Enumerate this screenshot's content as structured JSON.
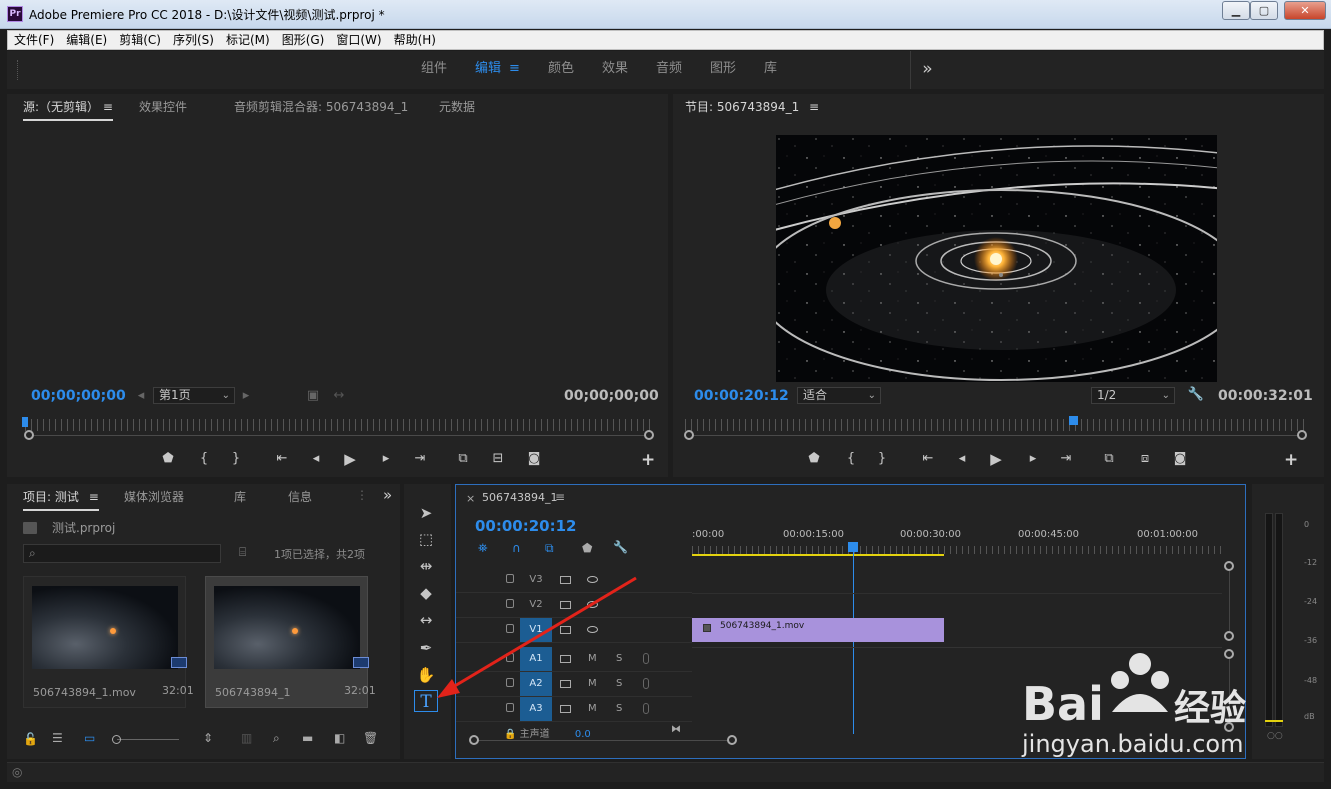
{
  "window": {
    "app_icon": "Pr",
    "title": "Adobe Premiere Pro CC 2018 - D:\\设计文件\\视频\\测试.prproj *",
    "minimize": "▁",
    "maximize": "▢",
    "close": "✕"
  },
  "menu": [
    "文件(F)",
    "编辑(E)",
    "剪辑(C)",
    "序列(S)",
    "标记(M)",
    "图形(G)",
    "窗口(W)",
    "帮助(H)"
  ],
  "workspaces": {
    "tabs": [
      "组件",
      "编辑",
      "颜色",
      "效果",
      "音频",
      "图形",
      "库"
    ],
    "active": "编辑",
    "more": "»"
  },
  "source": {
    "tabs": [
      "源:（无剪辑）",
      "效果控件",
      "音频剪辑混合器: 506743894_1",
      "元数据"
    ],
    "timecode_in": "00;00;00;00",
    "timecode_out": "00;00;00;00",
    "page_select": "第1页"
  },
  "program": {
    "tab": "节目: 506743894_1",
    "timecode": "00:00:20:12",
    "fit_select": "适合",
    "res_select": "1/2",
    "duration": "00:00:32:01"
  },
  "project": {
    "tabs": [
      "项目: 测试",
      "媒体浏览器",
      "库",
      "信息"
    ],
    "more": "»",
    "project_file": "测试.prproj",
    "selection_info": "1项已选择，共2项",
    "search_placeholder": "",
    "items": [
      {
        "name": "506743894_1.mov",
        "duration": "32:01"
      },
      {
        "name": "506743894_1",
        "duration": "32:01"
      }
    ]
  },
  "timeline": {
    "tab": "506743894_1",
    "close": "×",
    "timecode": "00:00:20:12",
    "ruler_labels": [
      ":00:00",
      "00:00:15:00",
      "00:00:30:00",
      "00:00:45:00",
      "00:01:00:00"
    ],
    "video_tracks": [
      "V3",
      "V2",
      "V1"
    ],
    "audio_tracks": [
      "A1",
      "A2",
      "A3"
    ],
    "master_label": "主声道",
    "master_value": "0.0",
    "clip_name": "506743894_1.mov",
    "ms_m": "M",
    "ms_s": "S"
  },
  "meter": {
    "scale": [
      "0",
      "-12",
      "-24",
      "-36",
      "-48",
      "dB"
    ]
  },
  "playhead_fraction": 0.625,
  "colors": {
    "accent": "#2d8ceb",
    "clip": "#a892dc",
    "track_on": "#1c5d93",
    "panel_bg": "#232323"
  }
}
